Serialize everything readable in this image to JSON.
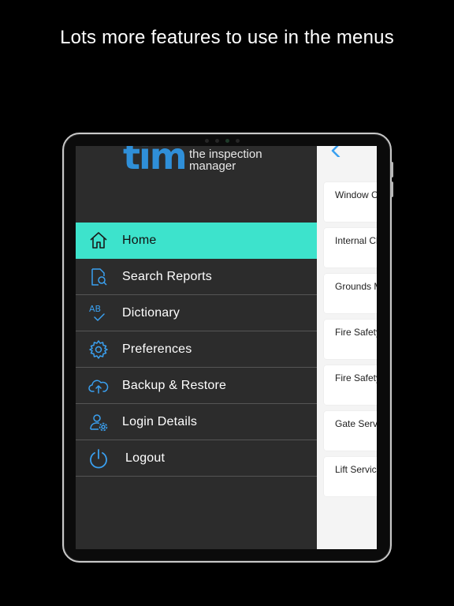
{
  "headline": "Lots more features to use in the menus",
  "logo": {
    "mark": "tim",
    "tagline_line1": "the inspection",
    "tagline_line2": "manager"
  },
  "menu": {
    "items": [
      {
        "label": "Home",
        "icon": "home-icon",
        "active": true
      },
      {
        "label": "Search Reports",
        "icon": "search-report-icon",
        "active": false
      },
      {
        "label": "Dictionary",
        "icon": "dictionary-ab-check-icon",
        "active": false
      },
      {
        "label": "Preferences",
        "icon": "gear-icon",
        "active": false
      },
      {
        "label": "Backup & Restore",
        "icon": "cloud-upload-icon",
        "active": false
      },
      {
        "label": "Login Details",
        "icon": "user-settings-icon",
        "active": false
      },
      {
        "label": "Logout",
        "icon": "power-icon",
        "active": false
      }
    ]
  },
  "content": {
    "back_icon": "chevron-left-icon",
    "cards": [
      {
        "label": "Window C"
      },
      {
        "label": "Internal Cl"
      },
      {
        "label": "Grounds M"
      },
      {
        "label": "Fire Safety"
      },
      {
        "label": "Fire Safety"
      },
      {
        "label": "Gate Servi"
      },
      {
        "label": "Lift Servic"
      }
    ]
  },
  "colors": {
    "accent": "#3de3cc",
    "brand_blue": "#2f8fd8",
    "sidebar_bg": "#2c2c2c",
    "icon_blue": "#3aa0f0"
  }
}
